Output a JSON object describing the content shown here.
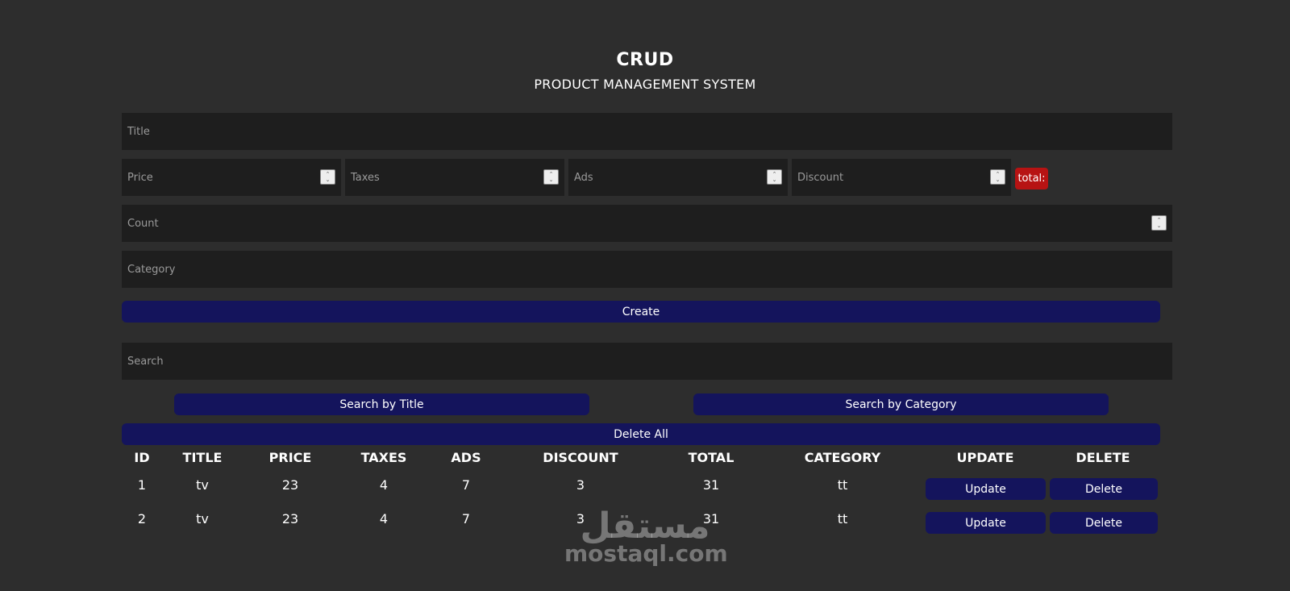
{
  "header": {
    "title": "CRUD",
    "subtitle": "PRODUCT MANAGEMENT SYSTEM"
  },
  "form": {
    "title_placeholder": "Title",
    "price_placeholder": "Price",
    "taxes_placeholder": "Taxes",
    "ads_placeholder": "Ads",
    "discount_placeholder": "Discount",
    "total_label": "total:",
    "count_placeholder": "Count",
    "category_placeholder": "Category",
    "create_label": "Create"
  },
  "search": {
    "placeholder": "Search",
    "by_title_label": "Search by Title",
    "by_category_label": "Search by Category",
    "delete_all_label": "Delete All"
  },
  "table": {
    "headers": [
      "ID",
      "TITLE",
      "PRICE",
      "TAXES",
      "ADS",
      "DISCOUNT",
      "TOTAL",
      "CATEGORY",
      "UPDATE",
      "DELETE"
    ],
    "rows": [
      {
        "id": "1",
        "title": "tv",
        "price": "23",
        "taxes": "4",
        "ads": "7",
        "discount": "3",
        "total": "31",
        "category": "tt",
        "update_label": "Update",
        "delete_label": "Delete"
      },
      {
        "id": "2",
        "title": "tv",
        "price": "23",
        "taxes": "4",
        "ads": "7",
        "discount": "3",
        "total": "31",
        "category": "tt",
        "update_label": "Update",
        "delete_label": "Delete"
      }
    ]
  },
  "watermark": {
    "logo_text": "مستقل",
    "url_text": "mostaql.com"
  },
  "colors": {
    "background": "#2d2d2d",
    "input_background": "#1e1e1e",
    "button": "#14145c",
    "total_badge": "#b71313"
  }
}
